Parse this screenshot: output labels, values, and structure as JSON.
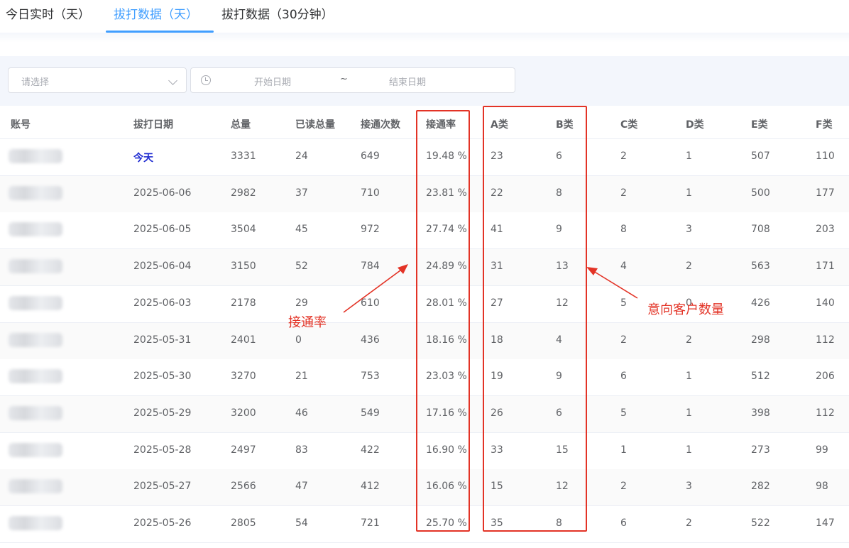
{
  "tabs": [
    {
      "label": "今日实时（天）"
    },
    {
      "label": "拔打数据（天）"
    },
    {
      "label": "拔打数据（30分钟）"
    }
  ],
  "filters": {
    "select_placeholder": "请选择",
    "start_placeholder": "开始日期",
    "range_separator": "~",
    "end_placeholder": "结束日期"
  },
  "table": {
    "columns": [
      "账号",
      "拔打日期",
      "总量",
      "已读总量",
      "接通次数",
      "接通率",
      "A类",
      "B类",
      "C类",
      "D类",
      "E类",
      "F类"
    ],
    "rows": [
      {
        "date": "今天",
        "total": "3331",
        "read": "24",
        "connected": "649",
        "rate": "19.48 %",
        "a": "23",
        "b": "6",
        "c": "2",
        "d": "1",
        "e": "507",
        "f": "110"
      },
      {
        "date": "2025-06-06",
        "total": "2982",
        "read": "37",
        "connected": "710",
        "rate": "23.81 %",
        "a": "22",
        "b": "8",
        "c": "2",
        "d": "1",
        "e": "500",
        "f": "177"
      },
      {
        "date": "2025-06-05",
        "total": "3504",
        "read": "45",
        "connected": "972",
        "rate": "27.74 %",
        "a": "41",
        "b": "9",
        "c": "8",
        "d": "3",
        "e": "708",
        "f": "203"
      },
      {
        "date": "2025-06-04",
        "total": "3150",
        "read": "52",
        "connected": "784",
        "rate": "24.89 %",
        "a": "31",
        "b": "13",
        "c": "4",
        "d": "2",
        "e": "563",
        "f": "171"
      },
      {
        "date": "2025-06-03",
        "total": "2178",
        "read": "29",
        "connected": "610",
        "rate": "28.01 %",
        "a": "27",
        "b": "12",
        "c": "5",
        "d": "0",
        "e": "426",
        "f": "140"
      },
      {
        "date": "2025-05-31",
        "total": "2401",
        "read": "0",
        "connected": "436",
        "rate": "18.16 %",
        "a": "18",
        "b": "4",
        "c": "2",
        "d": "2",
        "e": "298",
        "f": "112"
      },
      {
        "date": "2025-05-30",
        "total": "3270",
        "read": "21",
        "connected": "753",
        "rate": "23.03 %",
        "a": "19",
        "b": "9",
        "c": "6",
        "d": "1",
        "e": "512",
        "f": "206"
      },
      {
        "date": "2025-05-29",
        "total": "3200",
        "read": "46",
        "connected": "549",
        "rate": "17.16 %",
        "a": "26",
        "b": "6",
        "c": "5",
        "d": "1",
        "e": "398",
        "f": "112"
      },
      {
        "date": "2025-05-28",
        "total": "2497",
        "read": "83",
        "connected": "422",
        "rate": "16.90 %",
        "a": "33",
        "b": "15",
        "c": "1",
        "d": "1",
        "e": "273",
        "f": "99"
      },
      {
        "date": "2025-05-27",
        "total": "2566",
        "read": "47",
        "connected": "412",
        "rate": "16.06 %",
        "a": "15",
        "b": "12",
        "c": "2",
        "d": "3",
        "e": "282",
        "f": "98"
      },
      {
        "date": "2025-05-26",
        "total": "2805",
        "read": "54",
        "connected": "721",
        "rate": "25.70 %",
        "a": "35",
        "b": "8",
        "c": "6",
        "d": "2",
        "e": "522",
        "f": "147"
      }
    ]
  },
  "annotations": {
    "rate_label": "接通率",
    "intent_label": "意向客户数量",
    "color": "#e33326"
  },
  "colors": {
    "accent": "#409eff",
    "today": "#1e2bd1",
    "filter_bg": "#f3f6fc"
  }
}
